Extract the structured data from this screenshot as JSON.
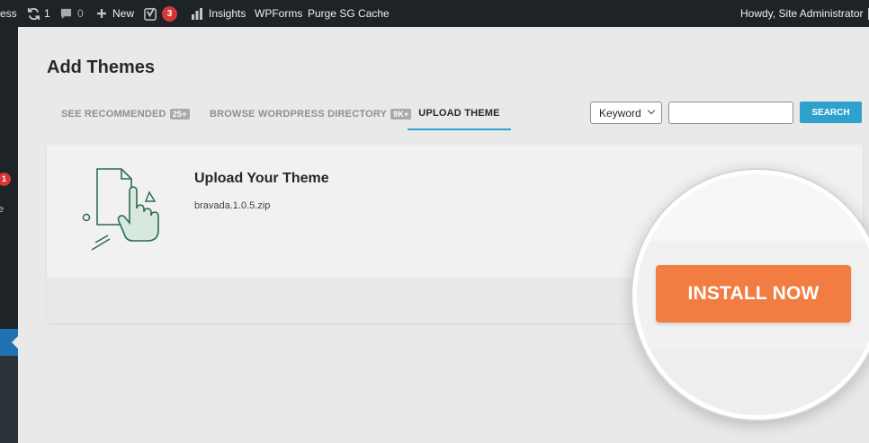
{
  "admin_bar": {
    "site_fragment": "ess",
    "updates_count": "1",
    "comments_count": "0",
    "new_label": "New",
    "yoast_count": "3",
    "insights_label": "Insights",
    "wpforms_label": "WPForms",
    "purge_label": "Purge SG Cache",
    "howdy": "Howdy, Site Administrator"
  },
  "sidebar": {
    "badge_count": "1",
    "truncated_label": "e"
  },
  "page": {
    "title": "Add Themes"
  },
  "tabs": [
    {
      "label": "See Recommended",
      "count": "25+"
    },
    {
      "label": "Browse WordPress Directory",
      "count": "9K+"
    },
    {
      "label": "Upload Theme"
    }
  ],
  "search": {
    "type_selected": "Keyword",
    "input_value": "",
    "button_label": "SEARCH"
  },
  "upload": {
    "heading": "Upload Your Theme",
    "file_name": "bravada.1.0.5.zip"
  },
  "install": {
    "button_label": "INSTALL NOW"
  },
  "colors": {
    "accent": "#2ea2cc",
    "install_button": "#f27d42",
    "admin_bar": "#1d2327",
    "illustration": "#2e6b4f"
  }
}
